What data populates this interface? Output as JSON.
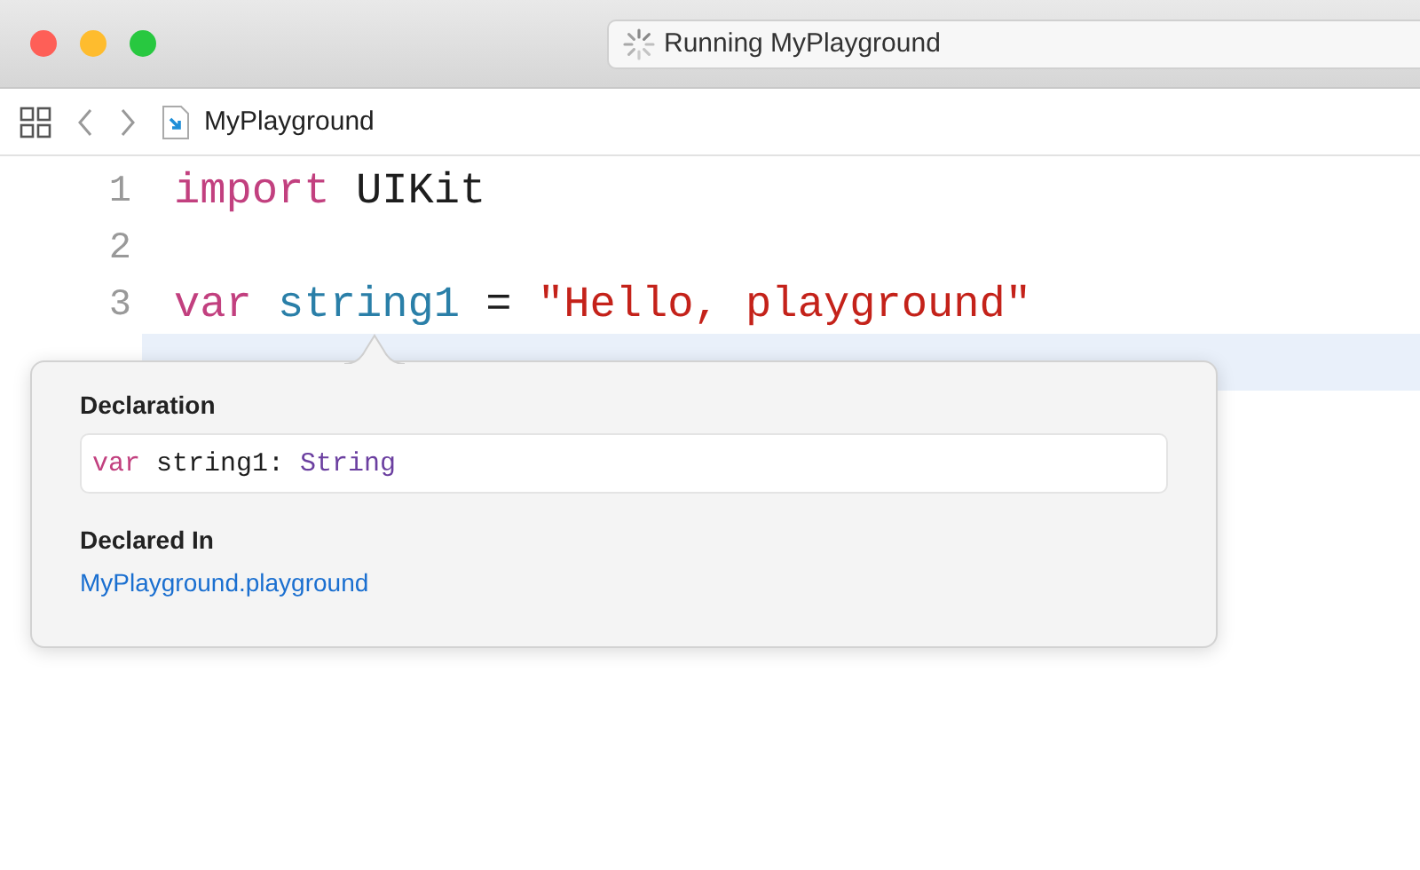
{
  "window": {
    "title": "Running MyPlayground"
  },
  "toolbar": {
    "file": "MyPlayground"
  },
  "editor": {
    "lines": [
      {
        "number": "1",
        "current": false,
        "tokens": [
          {
            "kind": "keyword",
            "text": "import"
          },
          {
            "kind": "plain",
            "text": " UIKit"
          }
        ]
      },
      {
        "number": "2",
        "current": false
      },
      {
        "number": "3",
        "current": false,
        "tokens": [
          {
            "kind": "keyword",
            "text": "var"
          },
          {
            "kind": "identifier",
            "text": " string1"
          },
          {
            "kind": "plain",
            "text": " = "
          },
          {
            "kind": "string",
            "text": "\"Hello, playground\""
          }
        ]
      },
      {
        "current": true
      }
    ]
  },
  "popover": {
    "sections": [
      {
        "kind": "code",
        "heading": "Declaration",
        "tokens": [
          {
            "kind": "keyword",
            "text": "var"
          },
          {
            "kind": "plain",
            "text": " string1: "
          },
          {
            "kind": "type",
            "text": "String"
          }
        ]
      },
      {
        "kind": "link",
        "heading": "Declared In",
        "text": "MyPlayground.playground"
      }
    ]
  }
}
